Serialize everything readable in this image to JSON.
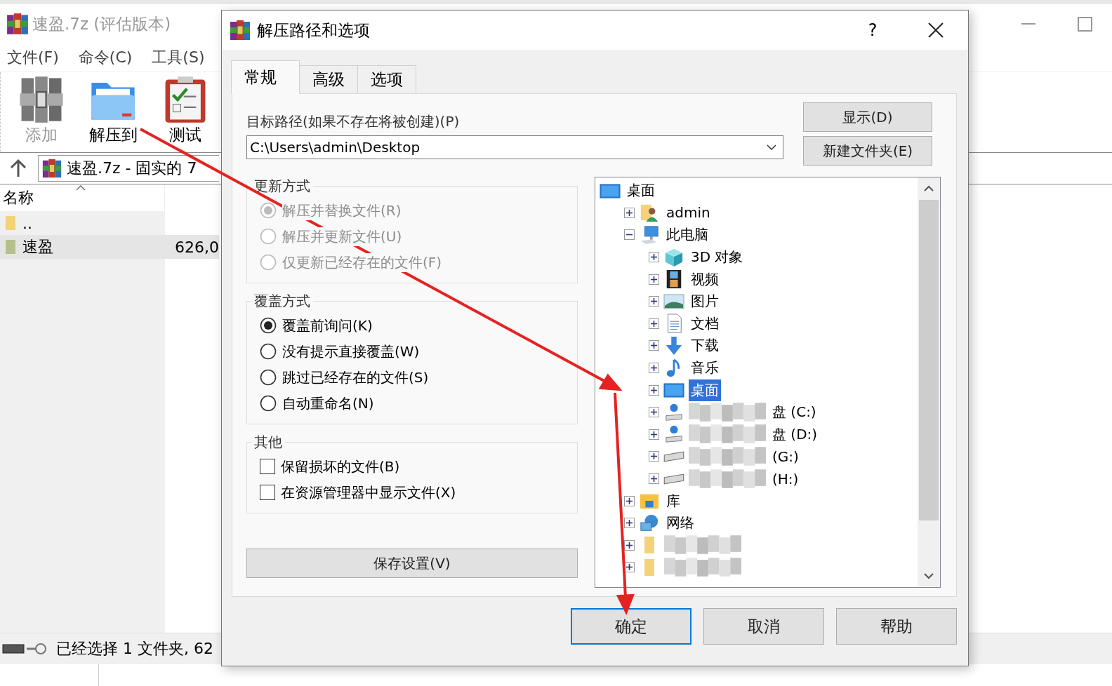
{
  "main_window": {
    "title": "速盈.7z (评估版本)",
    "menu": [
      "文件(F)",
      "命令(C)",
      "工具(S)"
    ],
    "toolbar": [
      {
        "label": "添加",
        "kind": "archive",
        "disabled": true
      },
      {
        "label": "解压到",
        "kind": "folder",
        "disabled": false
      },
      {
        "label": "测试",
        "kind": "clipboard",
        "disabled": false
      }
    ],
    "path": "速盈.7z - 固实的 7",
    "column": "名称",
    "rows": [
      {
        "name": "..",
        "selected": false
      },
      {
        "name": "速盈",
        "size": "626,0",
        "selected": true
      }
    ],
    "status": "已经选择 1 文件夹, 62"
  },
  "dialog": {
    "title": "解压路径和选项",
    "help": "?",
    "tabs": [
      {
        "label": "常规",
        "selected": true
      },
      {
        "label": "高级",
        "selected": false
      },
      {
        "label": "选项",
        "selected": false
      }
    ],
    "path_label": "目标路径(如果不存在将被创建)(P)",
    "path_value": "C:\\Users\\admin\\Desktop",
    "side_buttons": [
      "显示(D)",
      "新建文件夹(E)"
    ],
    "groups": [
      {
        "title": "更新方式",
        "disabled": true,
        "options": [
          {
            "kind": "radio",
            "label": "解压并替换文件(R)",
            "selected": true
          },
          {
            "kind": "radio",
            "label": "解压并更新文件(U)",
            "selected": false
          },
          {
            "kind": "radio",
            "label": "仅更新已经存在的文件(F)",
            "selected": false
          }
        ]
      },
      {
        "title": "覆盖方式",
        "disabled": false,
        "options": [
          {
            "kind": "radio",
            "label": "覆盖前询问(K)",
            "selected": true
          },
          {
            "kind": "radio",
            "label": "没有提示直接覆盖(W)",
            "selected": false
          },
          {
            "kind": "radio",
            "label": "跳过已经存在的文件(S)",
            "selected": false
          },
          {
            "kind": "radio",
            "label": "自动重命名(N)",
            "selected": false
          }
        ]
      },
      {
        "title": "其他",
        "disabled": false,
        "options": [
          {
            "kind": "checkbox",
            "label": "保留损坏的文件(B)",
            "checked": false
          },
          {
            "kind": "checkbox",
            "label": "在资源管理器中显示文件(X)",
            "checked": false
          }
        ]
      }
    ],
    "save_button": "保存设置(V)",
    "tree": [
      {
        "label": "桌面",
        "kind": "desktop",
        "selected": false,
        "children": [
          {
            "label": "admin",
            "kind": "user",
            "expanded": false,
            "selected": false
          },
          {
            "label": "此电脑",
            "kind": "pc",
            "expanded": true,
            "selected": false,
            "children": [
              {
                "label": "3D 对象",
                "kind": "cube",
                "expanded": false,
                "selected": false
              },
              {
                "label": "视频",
                "kind": "video",
                "expanded": false,
                "selected": false
              },
              {
                "label": "图片",
                "kind": "picture",
                "expanded": false,
                "selected": false
              },
              {
                "label": "文档",
                "kind": "doc",
                "expanded": false,
                "selected": false
              },
              {
                "label": "下载",
                "kind": "download",
                "expanded": false,
                "selected": false
              },
              {
                "label": "音乐",
                "kind": "music",
                "expanded": false,
                "selected": false
              },
              {
                "label": "桌面",
                "kind": "desktop",
                "expanded": false,
                "selected": true
              },
              {
                "label": "盘 (C:)",
                "kind": "netdrive",
                "expanded": false,
                "selected": false,
                "redacted": true
              },
              {
                "label": "盘 (D:)",
                "kind": "netdrive",
                "expanded": false,
                "selected": false,
                "redacted": true
              },
              {
                "label": "(G:)",
                "kind": "drive",
                "expanded": false,
                "selected": false,
                "redacted": true
              },
              {
                "label": "(H:)",
                "kind": "drive",
                "expanded": false,
                "selected": false,
                "redacted": true
              }
            ]
          },
          {
            "label": "库",
            "kind": "library",
            "expanded": false,
            "selected": false
          },
          {
            "label": "网络",
            "kind": "network",
            "expanded": false,
            "selected": false
          },
          {
            "kind": "folder",
            "expanded": false,
            "selected": false,
            "redacted": true
          },
          {
            "kind": "folder",
            "expanded": false,
            "selected": false,
            "redacted": true
          }
        ]
      }
    ],
    "buttons": [
      {
        "label": "确定",
        "focused": true
      },
      {
        "label": "取消",
        "focused": false
      },
      {
        "label": "帮助",
        "focused": false
      }
    ]
  }
}
